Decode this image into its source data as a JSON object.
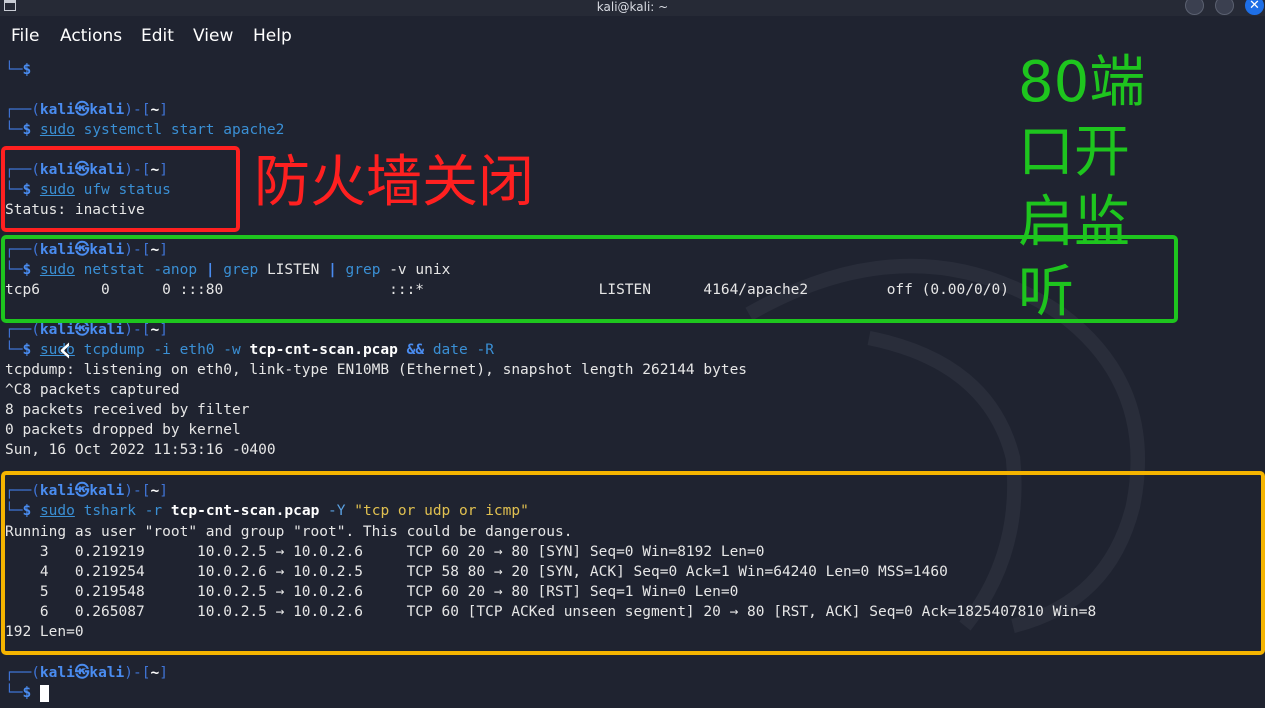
{
  "window": {
    "title": "kali@kali: ~",
    "app_icon": "terminal-icon",
    "buttons": [
      "minimize",
      "maximize",
      "close"
    ],
    "close_glyph": "✕"
  },
  "menu": [
    "File",
    "Actions",
    "Edit",
    "View",
    "Help"
  ],
  "prompt": {
    "user": "kali",
    "host": "kali",
    "at": "㉿",
    "dir": "~"
  },
  "lines": {
    "l0": "└─$",
    "p1_cmd": "systemctl start apache2",
    "p2_cmd": "ufw status",
    "status": "Status: inactive",
    "p3_cmd_a": "netstat -anop",
    "p3_cmd_b": "LISTEN",
    "p3_cmd_c": "-v unix",
    "netstat_row": "tcp6       0      0 :::80                   :::*                    LISTEN      4164/apache2         off (0.00/0/0)",
    "p4_cmd_a": "tcpdump -i eth0 -w",
    "p4_file": "tcp-cnt-scan.pcap",
    "p4_and": "&&",
    "p4_date": "date -R",
    "tcpdump_1": "tcpdump: listening on eth0, link-type EN10MB (Ethernet), snapshot length 262144 bytes",
    "tcpdump_2": "^C8 packets captured",
    "tcpdump_3": "8 packets received by filter",
    "tcpdump_4": "0 packets dropped by kernel",
    "tcpdump_5": "Sun, 16 Oct 2022 11:53:16 -0400",
    "p5_cmd_a": "tshark -r",
    "p5_file": "tcp-cnt-scan.pcap",
    "p5_opt": "-Y",
    "p5_filter": "\"tcp or udp or icmp\"",
    "tshark_warn": "Running as user \"root\" and group \"root\". This could be dangerous.",
    "pkt3": "    3   0.219219      10.0.2.5 → 10.0.2.6     TCP 60 20 → 80 [SYN] Seq=0 Win=8192 Len=0",
    "pkt4": "    4   0.219254      10.0.2.6 → 10.0.2.5     TCP 58 80 → 20 [SYN, ACK] Seq=0 Ack=1 Win=64240 Len=0 MSS=1460",
    "pkt5": "    5   0.219548      10.0.2.5 → 10.0.2.6     TCP 60 20 → 80 [RST] Seq=1 Win=0 Len=0",
    "pkt6a": "    6   0.265087      10.0.2.5 → 10.0.2.6     TCP 60 [TCP ACKed unseen segment] 20 → 80 [RST, ACK] Seq=0 Ack=1825407810 Win=8",
    "pkt6b": "192 Len=0"
  },
  "words": {
    "sudo": "sudo",
    "grep": "grep",
    "pipe": "|",
    "dollar": "$"
  },
  "annotations": {
    "firewall": "防火墙关闭",
    "port80": [
      "80端",
      "口开",
      "启监",
      "听"
    ]
  },
  "colors": {
    "red": "#ff2020",
    "green": "#1ec51e",
    "amber": "#f5b400",
    "bg": "#1f2330"
  },
  "overlay": {
    "back_glyph": "‹"
  }
}
